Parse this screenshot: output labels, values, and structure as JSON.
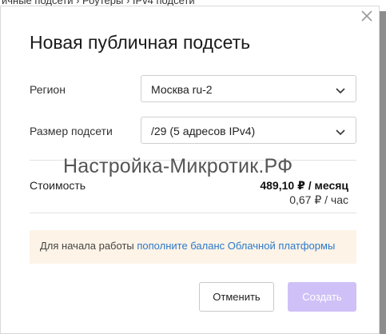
{
  "background": {
    "text": "ичные подсети  ›  Роутеры  ›  IPv4 подсети"
  },
  "dialog": {
    "title": "Новая публичная подсеть",
    "region": {
      "label": "Регион",
      "value": "Москва ru-2"
    },
    "subnet_size": {
      "label": "Размер подсети",
      "value": "/29 (5 адресов IPv4)"
    },
    "watermark": "Настройка-Микротик.РФ",
    "cost": {
      "label": "Стоимость",
      "monthly": "489,10 ₽ / месяц",
      "hourly": "0,67 ₽ / час"
    },
    "notice": {
      "text": "Для начала работы ",
      "link": "пополните баланс Облачной платформы"
    },
    "buttons": {
      "cancel": "Отменить",
      "create": "Создать"
    }
  },
  "colors": {
    "accent_disabled": "#cfc1f7",
    "link": "#2c79c9",
    "notice_bg": "#fdf3e7",
    "overlay": "#8d8d8d"
  },
  "icons": {
    "close": "close-icon",
    "select_arrow": "chevron-down-icon"
  }
}
